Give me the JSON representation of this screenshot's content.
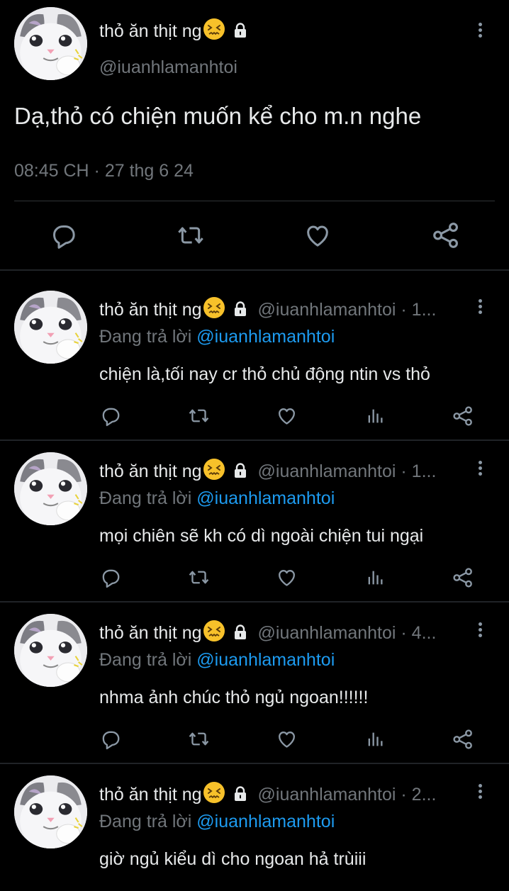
{
  "main_tweet": {
    "author_name": "thỏ ăn thịt ng",
    "handle": "@iuanhlamanhtoi",
    "text": "Dạ,thỏ có chiện muốn kể cho m.n nghe",
    "timestamp": "08:45 CH · 27 thg 6 24"
  },
  "replies": [
    {
      "author_name": "thỏ ăn thịt ng",
      "handle_meta": "@iuanhlamanhtoi · 1...",
      "replying_label": "Đang trả lời",
      "replying_to": "@iuanhlamanhtoi",
      "text": "chiện là,tối nay cr thỏ chủ động ntin vs thỏ"
    },
    {
      "author_name": "thỏ ăn thịt ng",
      "handle_meta": "@iuanhlamanhtoi · 1...",
      "replying_label": "Đang trả lời",
      "replying_to": "@iuanhlamanhtoi",
      "text": "mọi chiên sẽ kh có dì ngoài chiện tui ngại"
    },
    {
      "author_name": "thỏ ăn thịt ng",
      "handle_meta": "@iuanhlamanhtoi · 4...",
      "replying_label": "Đang trả lời",
      "replying_to": "@iuanhlamanhtoi",
      "text": "nhma ảnh chúc thỏ ngủ ngoan!!!!!!"
    },
    {
      "author_name": "thỏ ăn thịt ng",
      "handle_meta": "@iuanhlamanhtoi · 2...",
      "replying_label": "Đang trả lời",
      "replying_to": "@iuanhlamanhtoi",
      "text": "giờ ngủ kiểu dì cho ngoan hả trùiii"
    }
  ],
  "icons": {
    "author_emoji": "confounded-face-icon",
    "locked": "lock-icon",
    "actions": [
      "reply-icon",
      "retweet-icon",
      "like-icon",
      "views-icon",
      "share-icon"
    ]
  },
  "colors": {
    "background": "#000000",
    "text": "#e7e9ea",
    "muted": "#71767b",
    "link": "#1d9bf0",
    "divider": "#202327"
  }
}
